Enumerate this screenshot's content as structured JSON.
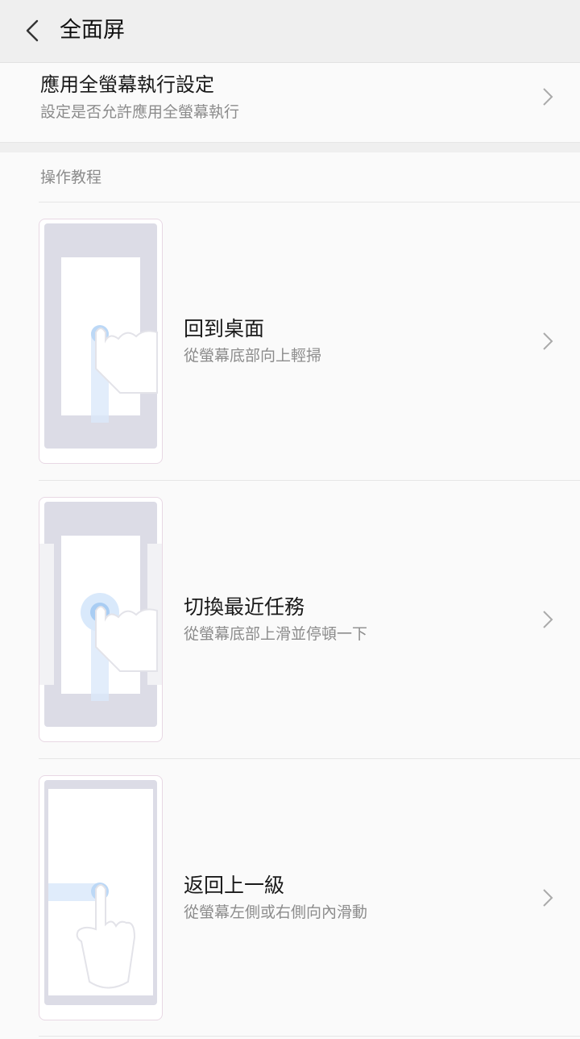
{
  "header": {
    "title": "全面屏",
    "back_icon": "chevron-left-icon"
  },
  "setting": {
    "title": "應用全螢幕執行設定",
    "subtitle": "設定是否允許應用全螢幕執行",
    "chevron_icon": "chevron-right-icon"
  },
  "section": {
    "label": "操作教程"
  },
  "tutorials": [
    {
      "title": "回到桌面",
      "subtitle": "從螢幕底部向上輕掃",
      "illustration": "swipe-up-home"
    },
    {
      "title": "切換最近任務",
      "subtitle": "從螢幕底部上滑並停頓一下",
      "illustration": "swipe-up-hold-recents"
    },
    {
      "title": "返回上一級",
      "subtitle": "從螢幕左側或右側向內滑動",
      "illustration": "swipe-side-back"
    }
  ],
  "colors": {
    "accent": "#9ec7f2",
    "frame": "#d9d9e3",
    "background": "#fafafa"
  }
}
